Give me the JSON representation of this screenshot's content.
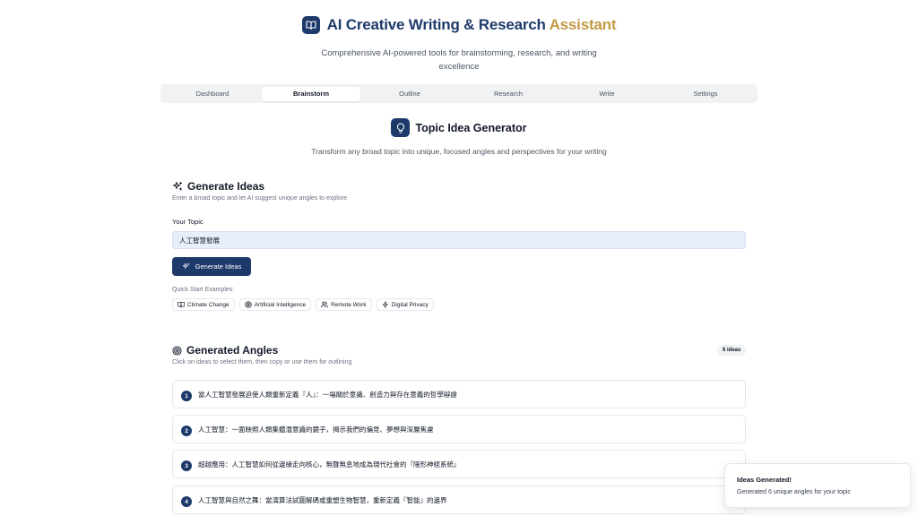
{
  "app": {
    "title_main": "AI Creative Writing & Research ",
    "title_accent": "Assistant",
    "subtitle": "Comprehensive AI-powered tools for brainstorming, research, and writing excellence"
  },
  "tabs": [
    {
      "label": "Dashboard",
      "active": false
    },
    {
      "label": "Brainstorm",
      "active": true
    },
    {
      "label": "Outline",
      "active": false
    },
    {
      "label": "Research",
      "active": false
    },
    {
      "label": "Write",
      "active": false
    },
    {
      "label": "Settings",
      "active": false
    }
  ],
  "section": {
    "title": "Topic Idea Generator",
    "description": "Transform any broad topic into unique, focused angles and perspectives for your writing"
  },
  "generate": {
    "heading": "Generate Ideas",
    "subheading": "Enter a broad topic and let AI suggest unique angles to explore",
    "topic_label": "Your Topic",
    "topic_value": "人工智慧發展",
    "button_label": "Generate Ideas",
    "quick_start_label": "Quick Start Examples:",
    "examples": [
      {
        "label": "Climate Change",
        "icon": "book-icon"
      },
      {
        "label": "Artificial Intelligence",
        "icon": "target-icon"
      },
      {
        "label": "Remote Work",
        "icon": "users-icon"
      },
      {
        "label": "Digital Privacy",
        "icon": "lightning-icon"
      }
    ]
  },
  "angles": {
    "heading": "Generated Angles",
    "count_badge": "6 ideas",
    "subheading": "Click on ideas to select them, then copy or use them for outlining",
    "items": [
      {
        "num": "1",
        "text": "當人工智慧發展迫使人類重新定義『人』：一場關於意識、創造力與存在意義的哲學辯證"
      },
      {
        "num": "2",
        "text": "人工智慧：一面映照人類集體潛意識的鏡子，揭示我們的偏見、夢想與深層焦慮"
      },
      {
        "num": "3",
        "text": "超越應用：人工智慧如何從邊緣走向核心，無聲無息地成為現代社會的『隱形神經系統』"
      },
      {
        "num": "4",
        "text": "人工智慧與自然之舞：當演算法試圖解碼或重塑生物智慧，重新定義『智能』的邊界"
      }
    ]
  },
  "toast": {
    "title": "Ideas Generated!",
    "message": "Generated 6 unique angles for your topic"
  },
  "colors": {
    "primary": "#1e3a6b",
    "accent": "#c29a45",
    "input_bg": "#e8eefa"
  }
}
